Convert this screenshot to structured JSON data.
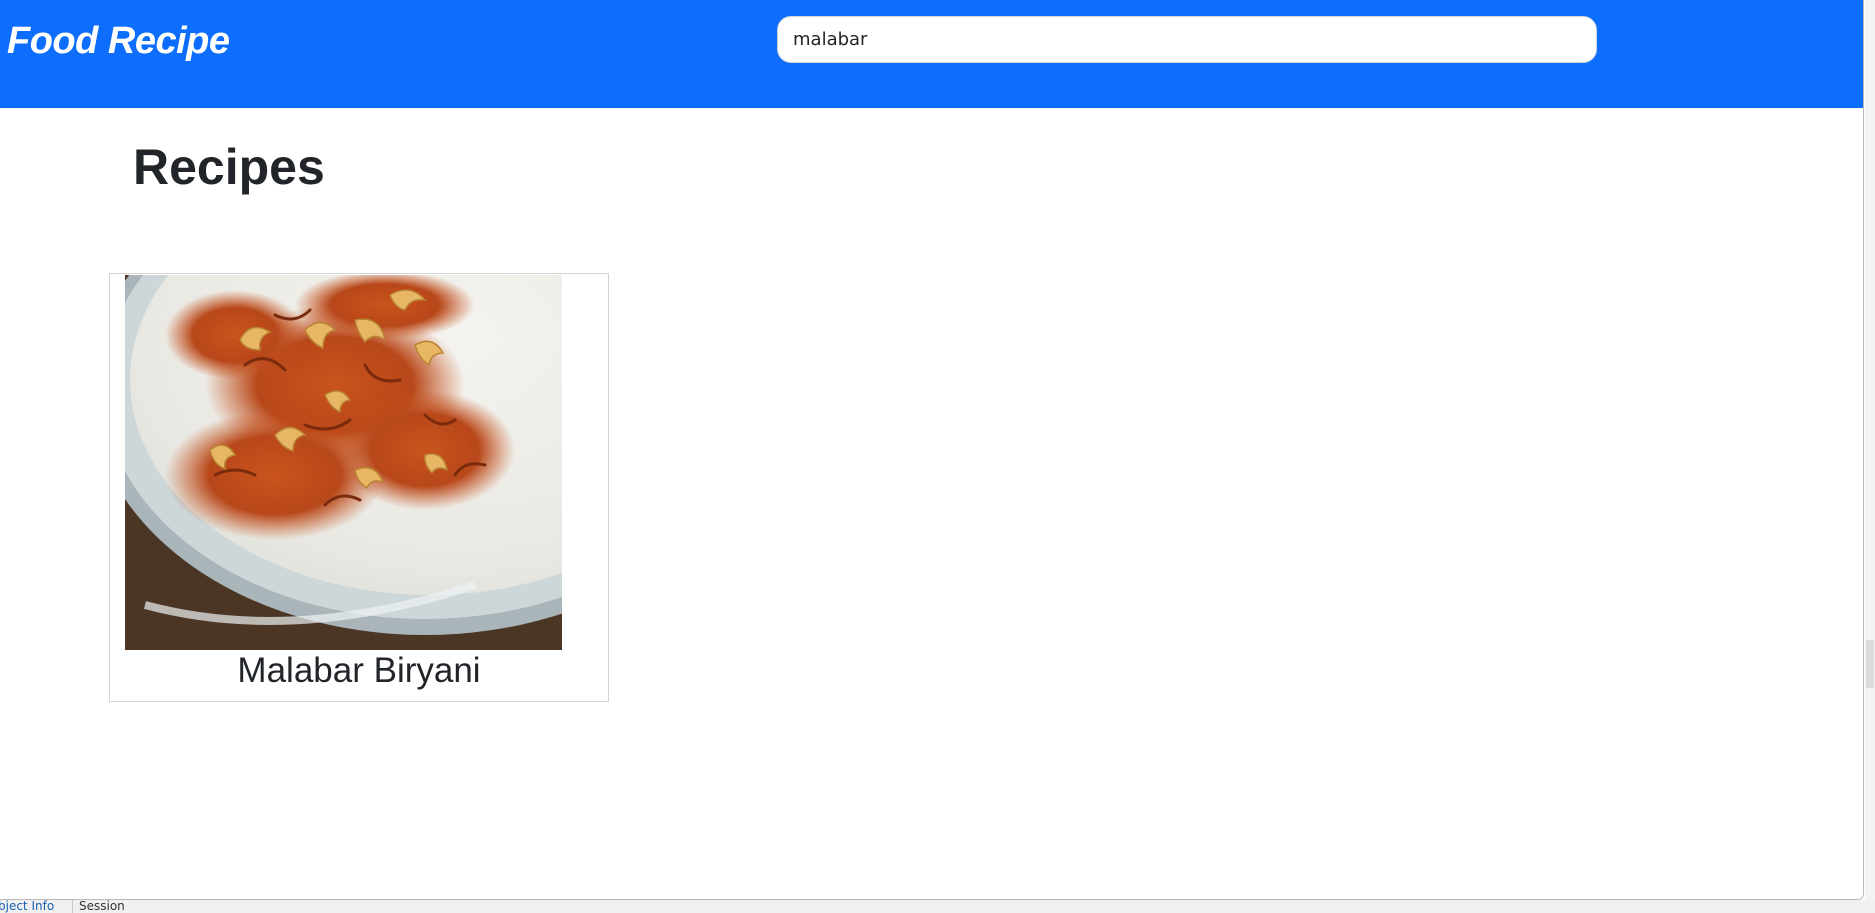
{
  "navbar": {
    "brand": "Food Recipe",
    "search": {
      "value": "malabar",
      "placeholder": ""
    },
    "color": "#0d6efd"
  },
  "main": {
    "title": "Recipes",
    "recipes": [
      {
        "name": "Malabar Biryani",
        "image_icon": "biryani-photo"
      }
    ]
  },
  "background_window": {
    "tabs": [
      "bject Info",
      "Session"
    ]
  }
}
